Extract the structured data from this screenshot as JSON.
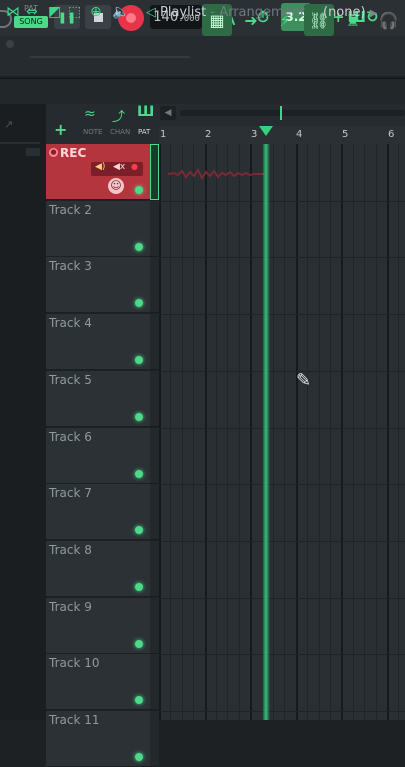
{
  "transport": {
    "pat_label": "PAT",
    "song_label": "SONG",
    "tempo_main": "140",
    "tempo_decimal": ".000",
    "snap_value": "3.2"
  },
  "playlist": {
    "title": "Playlist",
    "separator": " - ",
    "subtitle": "Arrangement",
    "pattern_selector": "(none)"
  },
  "columns": {
    "note": "NOTE",
    "chan": "CHAN",
    "pat": "PAT"
  },
  "ruler": {
    "bars": [
      "1",
      "2",
      "3",
      "4",
      "5",
      "6"
    ]
  },
  "tracks": [
    {
      "name": "REC",
      "recording": true
    },
    {
      "name": "Track 2"
    },
    {
      "name": "Track 3"
    },
    {
      "name": "Track 4"
    },
    {
      "name": "Track 5"
    },
    {
      "name": "Track 6"
    },
    {
      "name": "Track 7"
    },
    {
      "name": "Track 8"
    },
    {
      "name": "Track 9"
    },
    {
      "name": "Track 10"
    },
    {
      "name": "Track 11"
    }
  ],
  "colors": {
    "accent": "#4dd98a",
    "record": "#e8344a",
    "rec_track": "#b5353f",
    "playhead": "#34d27f"
  },
  "icons": {
    "tool_draw": "pencil-icon",
    "cursor": "mouse-pencil-icon"
  }
}
